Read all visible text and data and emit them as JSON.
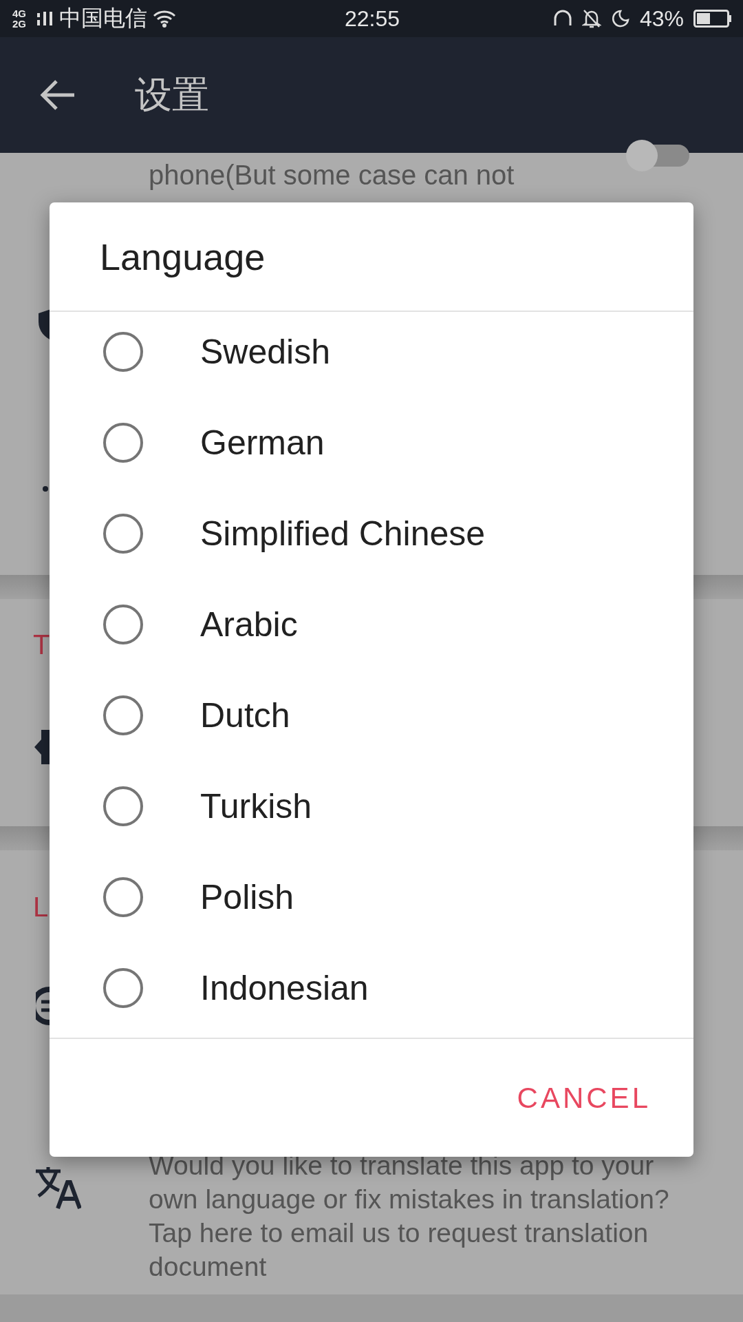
{
  "status_bar": {
    "network": "4G 2G",
    "carrier": "中国电信",
    "time": "22:55",
    "battery": "43%"
  },
  "app_bar": {
    "title": "设置"
  },
  "background": {
    "visible_text": "phone(But some case can not",
    "toggle": {
      "on": false
    },
    "section_headers": [
      "T",
      "L"
    ],
    "translate_note": "Would you like to translate this app to your own language or fix mistakes in translation? Tap here to email us to request translation document"
  },
  "dialog": {
    "title": "Language",
    "options": [
      {
        "label": "Swedish",
        "selected": false
      },
      {
        "label": "German",
        "selected": false
      },
      {
        "label": "Simplified Chinese",
        "selected": false
      },
      {
        "label": "Arabic",
        "selected": false
      },
      {
        "label": "Dutch",
        "selected": false
      },
      {
        "label": "Turkish",
        "selected": false
      },
      {
        "label": "Polish",
        "selected": false
      },
      {
        "label": "Indonesian",
        "selected": false
      }
    ],
    "buttons": [
      "CANCEL"
    ]
  }
}
